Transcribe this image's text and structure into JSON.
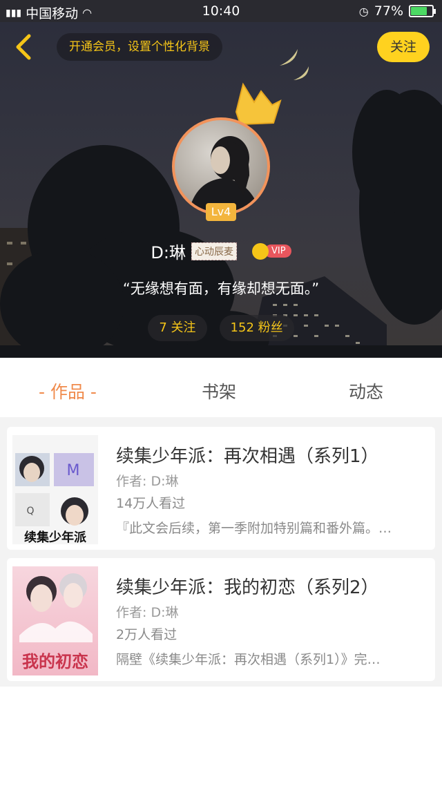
{
  "status_bar": {
    "carrier": "中国移动",
    "time": "10:40",
    "battery": "77%",
    "battery_level": 0.77
  },
  "header": {
    "member_banner": "开通会员，设置个性化背景",
    "follow_label": "关注"
  },
  "profile": {
    "level": "Lv4",
    "username": "D:琳",
    "title_tag": "心动辰麦",
    "vip_label": "VIP",
    "signature": "“无缘想有面，有缘却想无面。”",
    "following": "7 关注",
    "followers": "152 粉丝"
  },
  "tabs": [
    {
      "label": "- 作品 -",
      "active": true
    },
    {
      "label": "书架",
      "active": false
    },
    {
      "label": "动态",
      "active": false
    }
  ],
  "works": [
    {
      "title": "续集少年派：再次相遇（系列1）",
      "author": "作者: D:琳",
      "reads": "14万人看过",
      "description": "『此文会后续，第一季附加特别篇和番外篇。…",
      "cover_text": "续集少年派"
    },
    {
      "title": "续集少年派：我的初恋（系列2）",
      "author": "作者: D:琳",
      "reads": "2万人看过",
      "description": "隔壁《续集少年派：再次相遇（系列1）》完…",
      "cover_text": "我的初恋"
    }
  ],
  "colors": {
    "accent_orange": "#f08a4b",
    "accent_yellow": "#ffd21f",
    "vip_red": "#e8565d"
  }
}
